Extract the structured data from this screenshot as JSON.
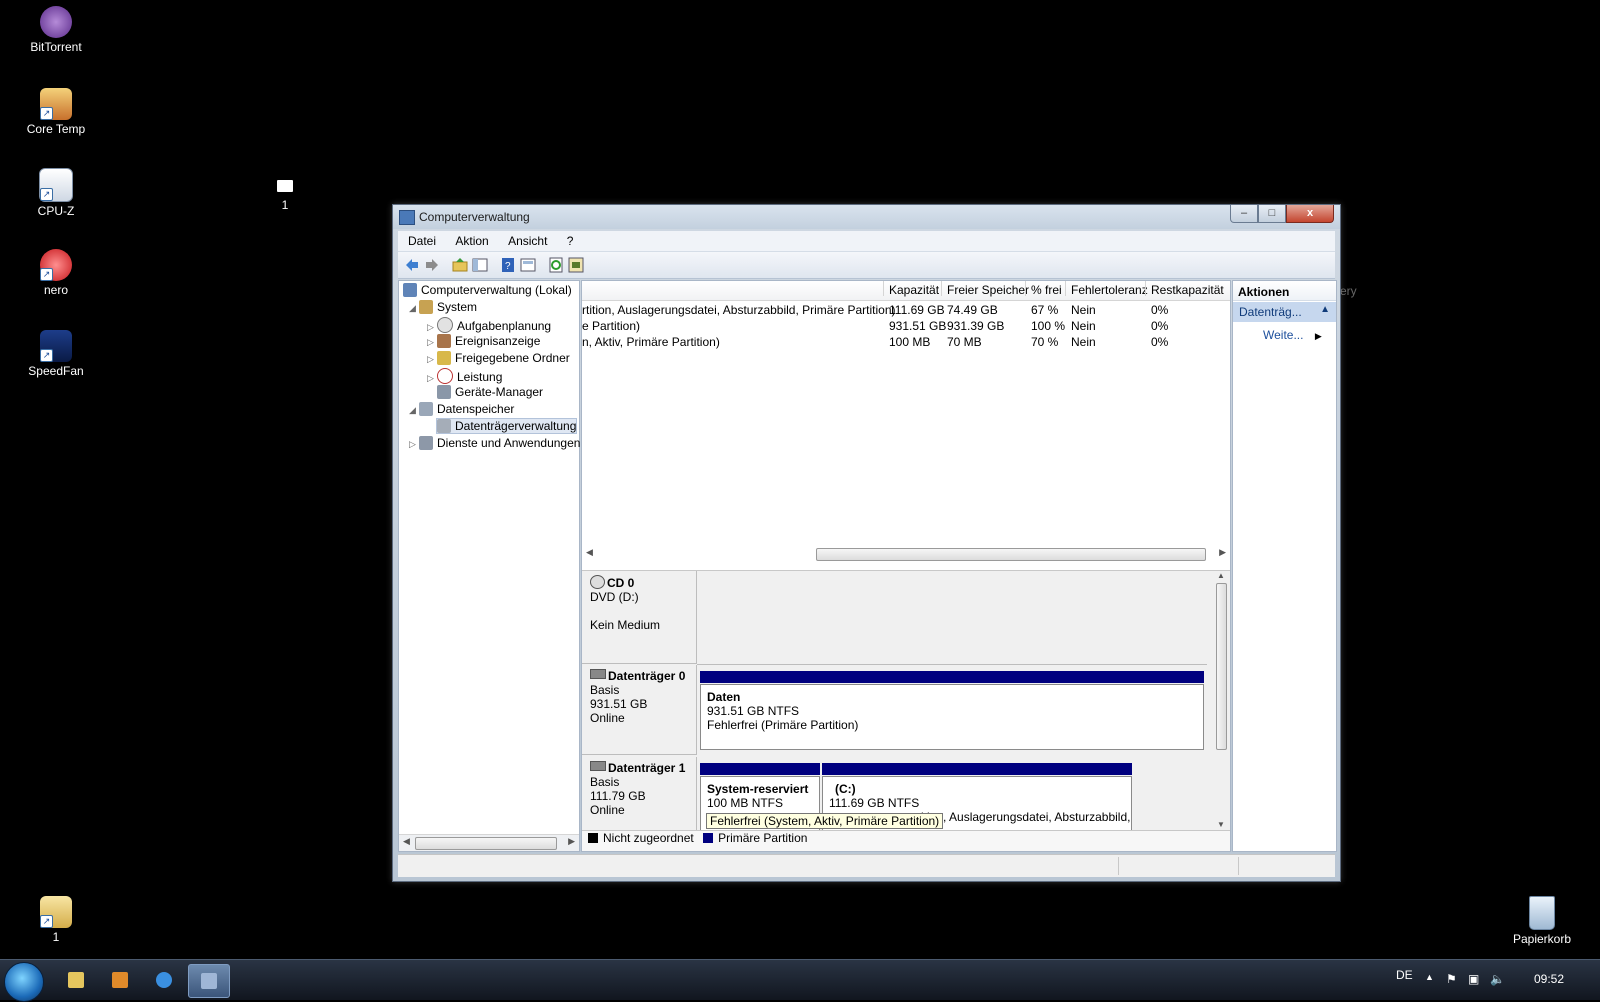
{
  "desktop": {
    "icons": [
      {
        "label": "BitTorrent"
      },
      {
        "label": "Core Temp"
      },
      {
        "label": "CPU-Z"
      },
      {
        "label": "nero"
      },
      {
        "label": "SpeedFan"
      },
      {
        "label": "1"
      },
      {
        "label": "1"
      },
      {
        "label": "Papierkorb"
      }
    ],
    "behind_window_fragment": "ery"
  },
  "window": {
    "title": "Computerverwaltung",
    "controls": {
      "minimize": "–",
      "maximize": "□",
      "close": "x"
    },
    "menu": [
      "Datei",
      "Aktion",
      "Ansicht",
      "?"
    ],
    "tree": {
      "root": "Computerverwaltung (Lokal)",
      "items": [
        {
          "label": "System"
        },
        {
          "label": "Aufgabenplanung"
        },
        {
          "label": "Ereignisanzeige"
        },
        {
          "label": "Freigegebene Ordner"
        },
        {
          "label": "Leistung"
        },
        {
          "label": "Geräte-Manager"
        },
        {
          "label": "Datenspeicher"
        },
        {
          "label": "Datenträgerverwaltung"
        },
        {
          "label": "Dienste und Anwendungen"
        }
      ]
    },
    "volume_list": {
      "columns": [
        "Kapazität",
        "Freier Speicher",
        "% frei",
        "Fehlertoleranz",
        "Restkapazität"
      ],
      "rows": [
        {
          "status": "rtition, Auslagerungsdatei, Absturzabbild, Primäre Partition)",
          "capacity": "111.69 GB",
          "free": "74.49 GB",
          "pct": "67 %",
          "fault": "Nein",
          "overhead": "0%"
        },
        {
          "status": "e Partition)",
          "capacity": "931.51 GB",
          "free": "931.39 GB",
          "pct": "100 %",
          "fault": "Nein",
          "overhead": "0%"
        },
        {
          "status": "n, Aktiv, Primäre Partition)",
          "capacity": "100 MB",
          "free": "70 MB",
          "pct": "70 %",
          "fault": "Nein",
          "overhead": "0%"
        }
      ]
    },
    "disks": {
      "cd0": {
        "name": "CD 0",
        "type": "DVD (D:)",
        "status": "Kein Medium"
      },
      "disk0": {
        "name": "Datenträger 0",
        "type": "Basis",
        "size": "931.51 GB",
        "state": "Online",
        "volume": {
          "name": "Daten",
          "fs": "931.51 GB NTFS",
          "status": "Fehlerfrei (Primäre Partition)"
        }
      },
      "disk1": {
        "name": "Datenträger 1",
        "type": "Basis",
        "size": "111.79 GB",
        "state": "Online",
        "vol1": {
          "name": "System-reserviert",
          "fs": "100 MB NTFS"
        },
        "vol2": {
          "name": "(C:)",
          "fs": "111.69 GB NTFS",
          "status_fragment": "ition, Auslagerungsdatei, Absturzabbild,"
        },
        "tooltip": "Fehlerfrei (System, Aktiv, Primäre Partition)"
      }
    },
    "legend": {
      "unallocated": "Nicht zugeordnet",
      "primary": "Primäre Partition"
    },
    "actions": {
      "header": "Aktionen",
      "group": "Datenträg...",
      "more": "Weite..."
    }
  },
  "taskbar": {
    "lang": "DE",
    "clock": "09:52"
  },
  "colors": {
    "partition_bar": "#00007f",
    "unallocated": "#000000"
  }
}
